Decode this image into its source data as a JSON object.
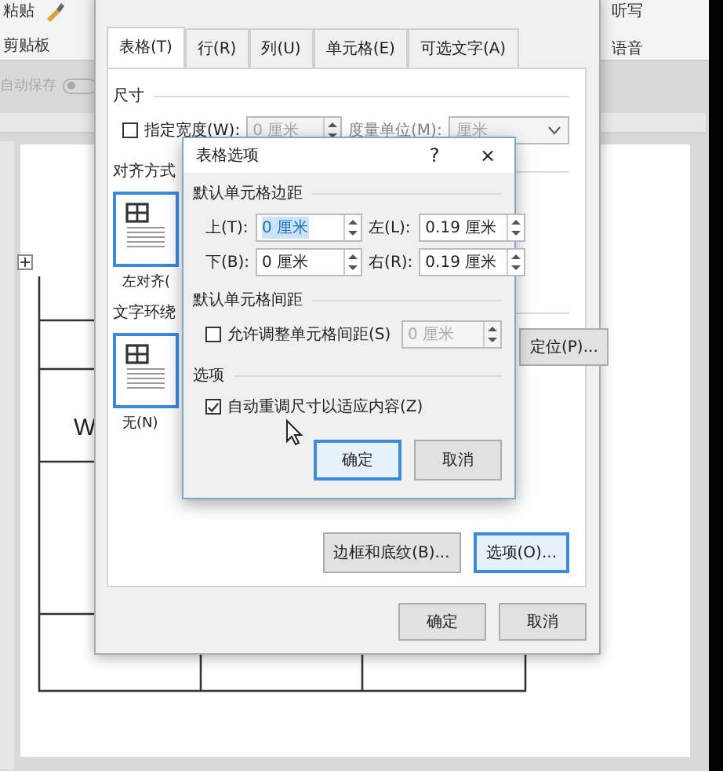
{
  "ribbon": {
    "left": [
      {
        "label": "粘贴"
      },
      {
        "label": "剪贴板"
      }
    ],
    "autosave": {
      "label": "自动保存",
      "on": false
    },
    "right": [
      {
        "label": "听写"
      },
      {
        "label": "语音"
      }
    ]
  },
  "document": {
    "text": "W"
  },
  "table_properties": {
    "tabs": [
      {
        "label": "表格(T)",
        "selected": true
      },
      {
        "label": "行(R)",
        "selected": false
      },
      {
        "label": "列(U)",
        "selected": false
      },
      {
        "label": "单元格(E)",
        "selected": false
      },
      {
        "label": "可选文字(A)",
        "selected": false
      }
    ],
    "size": {
      "heading": "尺寸",
      "width_checkbox": {
        "label": "指定宽度(W):",
        "checked": false
      },
      "width_field": {
        "value": "0 厘米",
        "disabled": true
      },
      "unit_label": "度量单位(M):",
      "unit_dropdown": {
        "value": "厘米",
        "disabled": true
      }
    },
    "alignment": {
      "heading": "对齐方式",
      "options": [
        {
          "label": "左对齐(",
          "selected": true
        }
      ]
    },
    "wrapping": {
      "heading": "文字环绕",
      "options": [
        {
          "label": "无(N)",
          "selected": true
        }
      ],
      "position_button": "定位(P)..."
    },
    "buttons": [
      {
        "label": "边框和底纹(B)...",
        "focused": false
      },
      {
        "label": "选项(O)...",
        "focused": true
      }
    ],
    "footer_buttons": [
      {
        "label": "确定"
      },
      {
        "label": "取消"
      }
    ]
  },
  "table_options": {
    "title": "表格选项",
    "help": "?",
    "close": "×",
    "margins": {
      "heading": "默认单元格边距",
      "fields": [
        {
          "label": "上(T):",
          "value": "0 厘米",
          "selected": true
        },
        {
          "label": "左(L):",
          "value": "0.19 厘米",
          "selected": false
        },
        {
          "label": "下(B):",
          "value": "0 厘米",
          "selected": false
        },
        {
          "label": "右(R):",
          "value": "0.19 厘米",
          "selected": false
        }
      ]
    },
    "spacing": {
      "heading": "默认单元格间距",
      "checkbox": {
        "label": "允许调整单元格间距(S)",
        "checked": false
      },
      "field": {
        "value": "0 厘米",
        "disabled": true
      }
    },
    "options": {
      "heading": "选项",
      "checkbox": {
        "label": "自动重调尺寸以适应内容(Z)",
        "checked": true
      }
    },
    "buttons": [
      {
        "label": "确定",
        "default": true
      },
      {
        "label": "取消",
        "default": false
      }
    ]
  }
}
